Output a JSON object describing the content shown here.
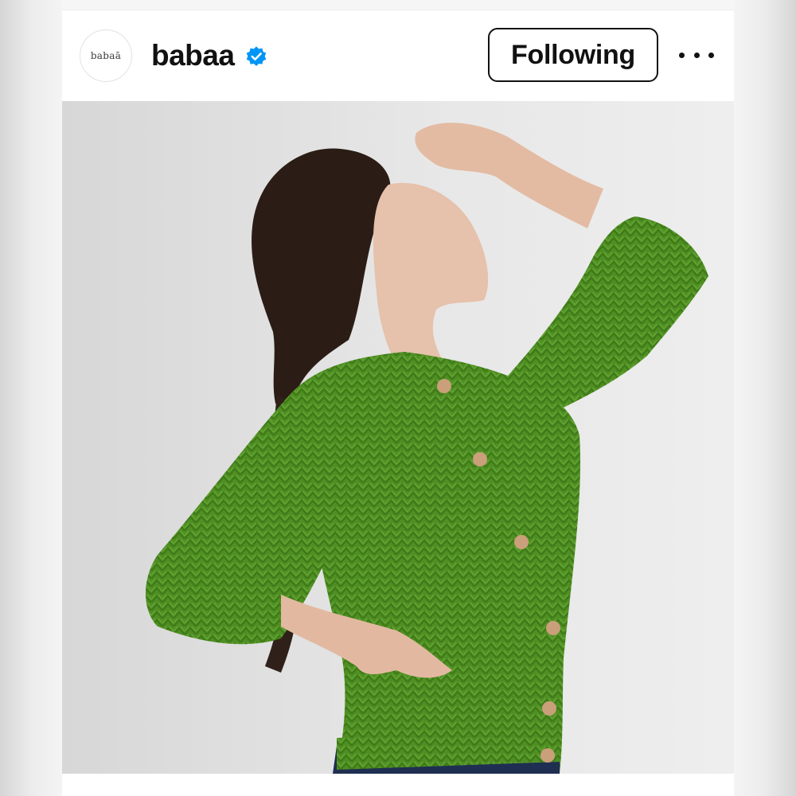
{
  "post": {
    "avatar_text": "babaā",
    "username": "babaa",
    "verified": true,
    "follow_label": "Following",
    "more_icon": "more-horizontal-icon",
    "verified_icon": "verified-badge-icon"
  },
  "colors": {
    "verified_blue": "#0095f6",
    "sweater_green": "#4f8f23",
    "text": "#111111"
  }
}
